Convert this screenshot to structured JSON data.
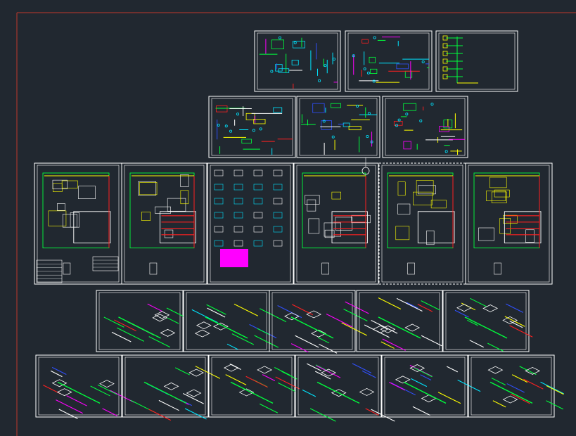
{
  "app": {
    "view": "model-space",
    "background": "#212830"
  },
  "colors": {
    "border_red": "#c0392b",
    "frame": "#ffffff",
    "green": "#00ff3c",
    "yellow": "#ffff00",
    "cyan": "#00e5ff",
    "red": "#ff2020",
    "magenta": "#ff00ff",
    "blue": "#3050ff",
    "white": "#ffffff"
  },
  "sheets": [
    {
      "id": "r1-1",
      "kind": "schematic"
    },
    {
      "id": "r1-2",
      "kind": "schematic"
    },
    {
      "id": "r1-3",
      "kind": "riser"
    },
    {
      "id": "r2-1",
      "kind": "schematic"
    },
    {
      "id": "r2-2",
      "kind": "schematic"
    },
    {
      "id": "r2-3",
      "kind": "schematic"
    },
    {
      "id": "r3-1",
      "kind": "floorplan"
    },
    {
      "id": "r3-2",
      "kind": "floorplan"
    },
    {
      "id": "r3-3",
      "kind": "details"
    },
    {
      "id": "r3-4",
      "kind": "floorplan"
    },
    {
      "id": "r3-5",
      "kind": "floorplan"
    },
    {
      "id": "r3-6",
      "kind": "floorplan"
    },
    {
      "id": "r4-1",
      "kind": "isometric"
    },
    {
      "id": "r4-2",
      "kind": "isometric"
    },
    {
      "id": "r4-3",
      "kind": "isometric"
    },
    {
      "id": "r4-4",
      "kind": "isometric"
    },
    {
      "id": "r4-5",
      "kind": "isometric"
    },
    {
      "id": "r5-1",
      "kind": "isometric"
    },
    {
      "id": "r5-2",
      "kind": "isometric"
    },
    {
      "id": "r5-3",
      "kind": "isometric"
    },
    {
      "id": "r5-4",
      "kind": "isometric"
    },
    {
      "id": "r5-5",
      "kind": "isometric"
    },
    {
      "id": "r5-6",
      "kind": "isometric"
    }
  ]
}
